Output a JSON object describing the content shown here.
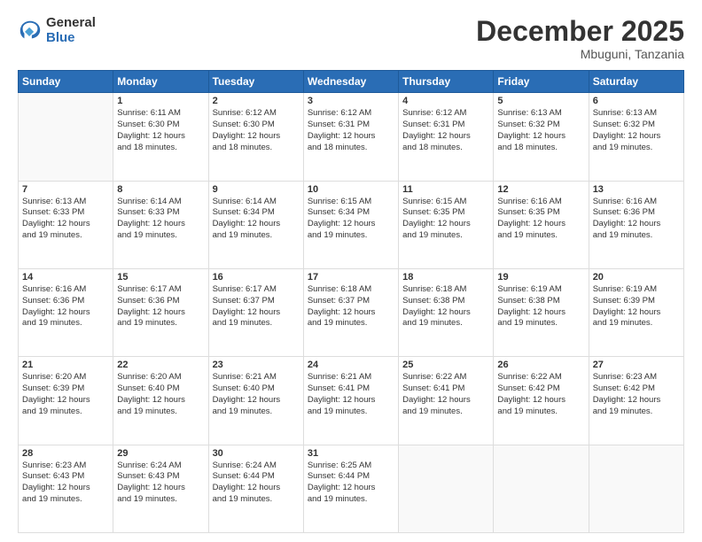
{
  "header": {
    "logo_general": "General",
    "logo_blue": "Blue",
    "month_title": "December 2025",
    "location": "Mbuguni, Tanzania"
  },
  "weekdays": [
    "Sunday",
    "Monday",
    "Tuesday",
    "Wednesday",
    "Thursday",
    "Friday",
    "Saturday"
  ],
  "weeks": [
    [
      {
        "day": "",
        "info": ""
      },
      {
        "day": "1",
        "info": "Sunrise: 6:11 AM\nSunset: 6:30 PM\nDaylight: 12 hours\nand 18 minutes."
      },
      {
        "day": "2",
        "info": "Sunrise: 6:12 AM\nSunset: 6:30 PM\nDaylight: 12 hours\nand 18 minutes."
      },
      {
        "day": "3",
        "info": "Sunrise: 6:12 AM\nSunset: 6:31 PM\nDaylight: 12 hours\nand 18 minutes."
      },
      {
        "day": "4",
        "info": "Sunrise: 6:12 AM\nSunset: 6:31 PM\nDaylight: 12 hours\nand 18 minutes."
      },
      {
        "day": "5",
        "info": "Sunrise: 6:13 AM\nSunset: 6:32 PM\nDaylight: 12 hours\nand 18 minutes."
      },
      {
        "day": "6",
        "info": "Sunrise: 6:13 AM\nSunset: 6:32 PM\nDaylight: 12 hours\nand 19 minutes."
      }
    ],
    [
      {
        "day": "7",
        "info": ""
      },
      {
        "day": "8",
        "info": "Sunrise: 6:14 AM\nSunset: 6:33 PM\nDaylight: 12 hours\nand 19 minutes."
      },
      {
        "day": "9",
        "info": "Sunrise: 6:14 AM\nSunset: 6:34 PM\nDaylight: 12 hours\nand 19 minutes."
      },
      {
        "day": "10",
        "info": "Sunrise: 6:15 AM\nSunset: 6:34 PM\nDaylight: 12 hours\nand 19 minutes."
      },
      {
        "day": "11",
        "info": "Sunrise: 6:15 AM\nSunset: 6:35 PM\nDaylight: 12 hours\nand 19 minutes."
      },
      {
        "day": "12",
        "info": "Sunrise: 6:16 AM\nSunset: 6:35 PM\nDaylight: 12 hours\nand 19 minutes."
      },
      {
        "day": "13",
        "info": "Sunrise: 6:16 AM\nSunset: 6:36 PM\nDaylight: 12 hours\nand 19 minutes."
      }
    ],
    [
      {
        "day": "14",
        "info": ""
      },
      {
        "day": "15",
        "info": "Sunrise: 6:17 AM\nSunset: 6:36 PM\nDaylight: 12 hours\nand 19 minutes."
      },
      {
        "day": "16",
        "info": "Sunrise: 6:17 AM\nSunset: 6:37 PM\nDaylight: 12 hours\nand 19 minutes."
      },
      {
        "day": "17",
        "info": "Sunrise: 6:18 AM\nSunset: 6:37 PM\nDaylight: 12 hours\nand 19 minutes."
      },
      {
        "day": "18",
        "info": "Sunrise: 6:18 AM\nSunset: 6:38 PM\nDaylight: 12 hours\nand 19 minutes."
      },
      {
        "day": "19",
        "info": "Sunrise: 6:19 AM\nSunset: 6:38 PM\nDaylight: 12 hours\nand 19 minutes."
      },
      {
        "day": "20",
        "info": "Sunrise: 6:19 AM\nSunset: 6:39 PM\nDaylight: 12 hours\nand 19 minutes."
      }
    ],
    [
      {
        "day": "21",
        "info": ""
      },
      {
        "day": "22",
        "info": "Sunrise: 6:20 AM\nSunset: 6:40 PM\nDaylight: 12 hours\nand 19 minutes."
      },
      {
        "day": "23",
        "info": "Sunrise: 6:21 AM\nSunset: 6:40 PM\nDaylight: 12 hours\nand 19 minutes."
      },
      {
        "day": "24",
        "info": "Sunrise: 6:21 AM\nSunset: 6:41 PM\nDaylight: 12 hours\nand 19 minutes."
      },
      {
        "day": "25",
        "info": "Sunrise: 6:22 AM\nSunset: 6:41 PM\nDaylight: 12 hours\nand 19 minutes."
      },
      {
        "day": "26",
        "info": "Sunrise: 6:22 AM\nSunset: 6:42 PM\nDaylight: 12 hours\nand 19 minutes."
      },
      {
        "day": "27",
        "info": "Sunrise: 6:23 AM\nSunset: 6:42 PM\nDaylight: 12 hours\nand 19 minutes."
      }
    ],
    [
      {
        "day": "28",
        "info": "Sunrise: 6:23 AM\nSunset: 6:43 PM\nDaylight: 12 hours\nand 19 minutes."
      },
      {
        "day": "29",
        "info": "Sunrise: 6:24 AM\nSunset: 6:43 PM\nDaylight: 12 hours\nand 19 minutes."
      },
      {
        "day": "30",
        "info": "Sunrise: 6:24 AM\nSunset: 6:44 PM\nDaylight: 12 hours\nand 19 minutes."
      },
      {
        "day": "31",
        "info": "Sunrise: 6:25 AM\nSunset: 6:44 PM\nDaylight: 12 hours\nand 19 minutes."
      },
      {
        "day": "",
        "info": ""
      },
      {
        "day": "",
        "info": ""
      },
      {
        "day": "",
        "info": ""
      }
    ]
  ],
  "week1_sunday_info": "Sunrise: 6:13 AM\nSunset: 6:33 PM\nDaylight: 12 hours\nand 19 minutes.",
  "week3_sunday_info": "Sunrise: 6:16 AM\nSunset: 6:36 PM\nDaylight: 12 hours\nand 19 minutes.",
  "week4_sunday_info": "Sunrise: 6:20 AM\nSunset: 6:39 PM\nDaylight: 12 hours\nand 19 minutes."
}
